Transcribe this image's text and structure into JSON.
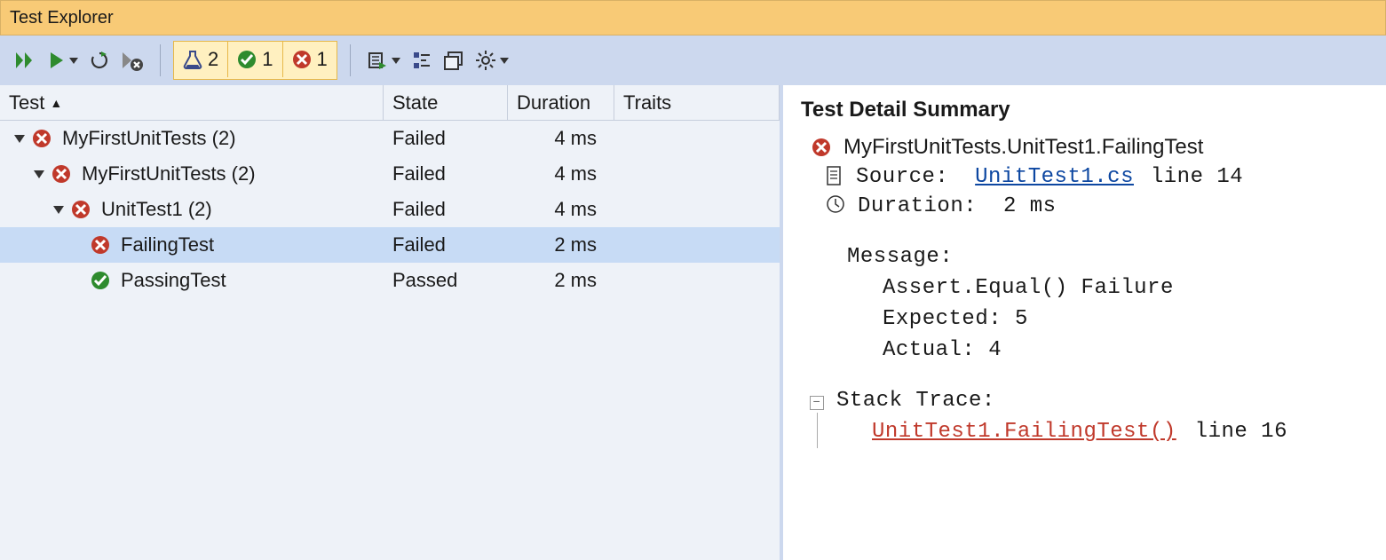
{
  "window": {
    "title": "Test Explorer"
  },
  "toolbar": {
    "filters": {
      "total": "2",
      "passed": "1",
      "failed": "1"
    }
  },
  "grid": {
    "headers": {
      "test": "Test",
      "state": "State",
      "duration": "Duration",
      "traits": "Traits"
    },
    "rows": [
      {
        "indent": 0,
        "expander": true,
        "icon": "fail",
        "label": "MyFirstUnitTests  (2)",
        "state": "Failed",
        "duration": "4 ms",
        "selected": false
      },
      {
        "indent": 1,
        "expander": true,
        "icon": "fail",
        "label": "MyFirstUnitTests  (2)",
        "state": "Failed",
        "duration": "4 ms",
        "selected": false
      },
      {
        "indent": 2,
        "expander": true,
        "icon": "fail",
        "label": "UnitTest1  (2)",
        "state": "Failed",
        "duration": "4 ms",
        "selected": false
      },
      {
        "indent": 3,
        "expander": false,
        "icon": "fail",
        "label": "FailingTest",
        "state": "Failed",
        "duration": "2 ms",
        "selected": true
      },
      {
        "indent": 3,
        "expander": false,
        "icon": "pass",
        "label": "PassingTest",
        "state": "Passed",
        "duration": "2 ms",
        "selected": false
      }
    ]
  },
  "detail": {
    "title": "Test Detail Summary",
    "name": "MyFirstUnitTests.UnitTest1.FailingTest",
    "source_label": "Source:",
    "source_file": "UnitTest1.cs",
    "source_line_text": "line 14",
    "duration_label": "Duration:",
    "duration_value": "2 ms",
    "message_label": "Message:",
    "message_lines": [
      "Assert.Equal() Failure",
      "Expected: 5",
      "Actual:   4"
    ],
    "stack_label": "Stack Trace:",
    "stack_link": "UnitTest1.FailingTest()",
    "stack_line_text": "line 16"
  }
}
